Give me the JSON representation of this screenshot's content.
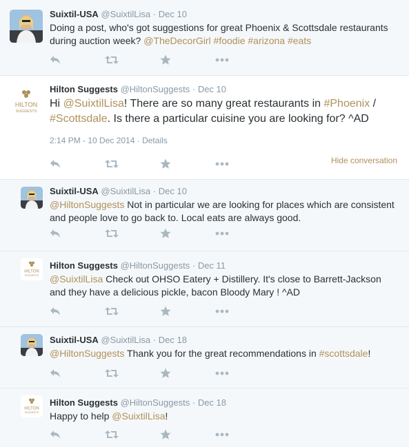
{
  "tweets": [
    {
      "name": "Suixtil-USA",
      "handle": "@SuixtilLisa",
      "date": "Dec 10",
      "segments": [
        {
          "t": "Doing a post, who's got suggestions for great Phoenix & Scottsdale restaurants during auction week? "
        },
        {
          "t": "@TheDecorGirl",
          "link": true
        },
        {
          "t": " "
        },
        {
          "t": "#foodie",
          "link": true
        },
        {
          "t": " "
        },
        {
          "t": "#arizona",
          "link": true
        },
        {
          "t": " "
        },
        {
          "t": "#eats",
          "link": true
        }
      ]
    },
    {
      "name": "Hilton Suggests",
      "handle": "@HiltonSuggests",
      "date": "Dec 10",
      "segments": [
        {
          "t": "Hi "
        },
        {
          "t": "@SuixtilLisa",
          "link": true
        },
        {
          "t": "! There are so many great restaurants in "
        },
        {
          "t": "#Phoenix",
          "link": true
        },
        {
          "t": " / "
        },
        {
          "t": "#Scottsdale",
          "link": true
        },
        {
          "t": ". Is there a particular cuisine you are looking for? ^AD"
        }
      ],
      "timestamp": "2:14 PM - 10 Dec 2014",
      "details": "Details",
      "hide_conversation": "Hide conversation"
    },
    {
      "name": "Suixtil-USA",
      "handle": "@SuixtilLisa",
      "date": "Dec 10",
      "segments": [
        {
          "t": "@HiltonSuggests",
          "link": true
        },
        {
          "t": " Not in particular we are looking for places which are consistent and people love to go back to.  Local eats are always good."
        }
      ]
    },
    {
      "name": "Hilton Suggests",
      "handle": "@HiltonSuggests",
      "date": "Dec 11",
      "segments": [
        {
          "t": "@SuixtilLisa",
          "link": true
        },
        {
          "t": " Check out OHSO Eatery + Distillery. It's close to Barrett-Jackson and they have a delicious pickle, bacon Bloody Mary ! ^AD"
        }
      ]
    },
    {
      "name": "Suixtil-USA",
      "handle": "@SuixtilLisa",
      "date": "Dec 18",
      "segments": [
        {
          "t": "@HiltonSuggests",
          "link": true
        },
        {
          "t": " Thank you for the great recommendations in "
        },
        {
          "t": "#scottsdale",
          "link": true
        },
        {
          "t": "!"
        }
      ]
    },
    {
      "name": "Hilton Suggests",
      "handle": "@HiltonSuggests",
      "date": "Dec 18",
      "segments": [
        {
          "t": "Happy to help "
        },
        {
          "t": "@SuixtilLisa",
          "link": true
        },
        {
          "t": "!"
        }
      ]
    }
  ],
  "logo_text": {
    "top": "HILTON",
    "bottom": "SUGGESTS"
  },
  "icons": [
    "reply-icon",
    "retweet-icon",
    "favorite-icon",
    "more-icon"
  ],
  "colors": {
    "link": "#b0905a",
    "muted": "#8899a6",
    "text": "#292f33",
    "icon": "#aab8c2",
    "reply_bg": "#f5f8fa"
  }
}
